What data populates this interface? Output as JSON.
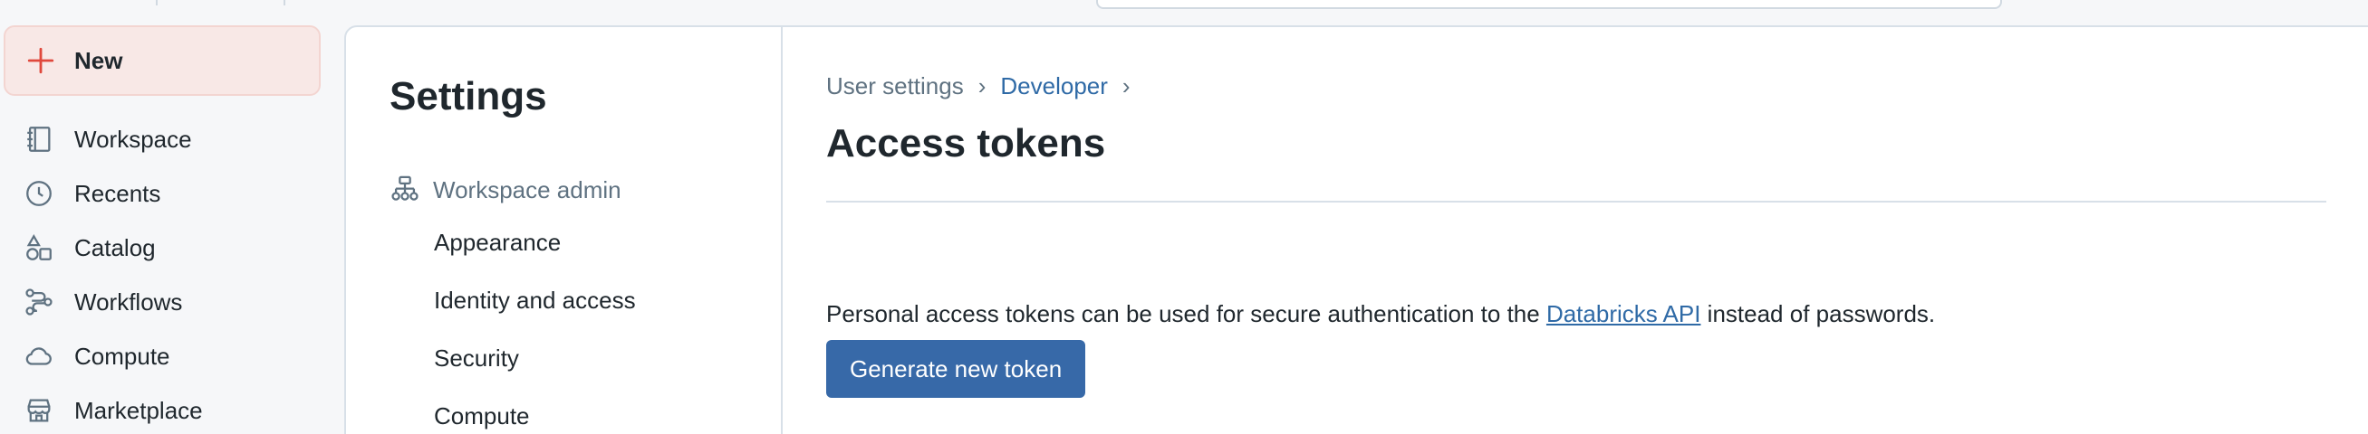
{
  "nav": {
    "new_label": "New",
    "items": [
      {
        "label": "Workspace",
        "icon": "workspace-icon"
      },
      {
        "label": "Recents",
        "icon": "clock-icon"
      },
      {
        "label": "Catalog",
        "icon": "catalog-icon"
      },
      {
        "label": "Workflows",
        "icon": "workflows-icon"
      },
      {
        "label": "Compute",
        "icon": "cloud-icon"
      },
      {
        "label": "Marketplace",
        "icon": "store-icon"
      }
    ]
  },
  "settings": {
    "title": "Settings",
    "section_label": "Workspace admin",
    "sub_items": [
      "Appearance",
      "Identity and access",
      "Security",
      "Compute"
    ]
  },
  "content": {
    "breadcrumb": [
      "User settings",
      "Developer"
    ],
    "title": "Access tokens",
    "desc_before": "Personal access tokens can be used for secure authentication to the ",
    "desc_link": "Databricks API",
    "desc_after": " instead of passwords.",
    "button_label": "Generate new token"
  },
  "colors": {
    "accent_red": "#e0483c",
    "link_blue": "#2f6aa6",
    "primary_button": "#3769a8"
  }
}
